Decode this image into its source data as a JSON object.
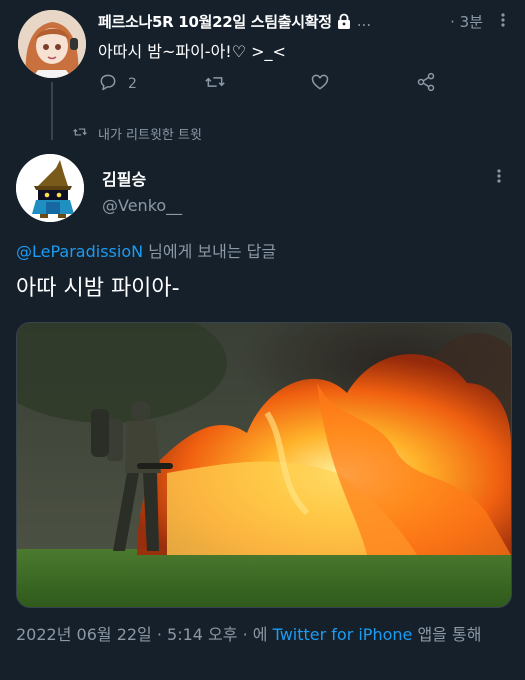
{
  "parent_tweet": {
    "author_name": "페르소나5R 10월22일 스팀출시확정",
    "handle": "...",
    "time": "· 3분",
    "text": "아따시 밤~파이-아!♡ >_<",
    "reply_count": "2",
    "icons": [
      "lock-icon",
      "more-icon",
      "reply-icon",
      "retweet-icon",
      "like-icon",
      "share-icon"
    ]
  },
  "retweet_note": "내가 리트윗한 트윗",
  "tweet": {
    "author_name": "김필승",
    "handle": "@Venko__",
    "reply_to_handle": "@LeParadissioN",
    "reply_to_suffix": " 님에게 보내는 답글",
    "text": "아따 시밤 파이아-",
    "date": "2022년 06월 22일 · 5:14 오후",
    "via_prefix": " · 에 ",
    "source": "Twitter for iPhone",
    "via_suffix": " 앱을 통해"
  },
  "colors": {
    "background": "#15202b",
    "text": "#ffffff",
    "muted": "#8b98a5",
    "link": "#1d9bf0"
  }
}
